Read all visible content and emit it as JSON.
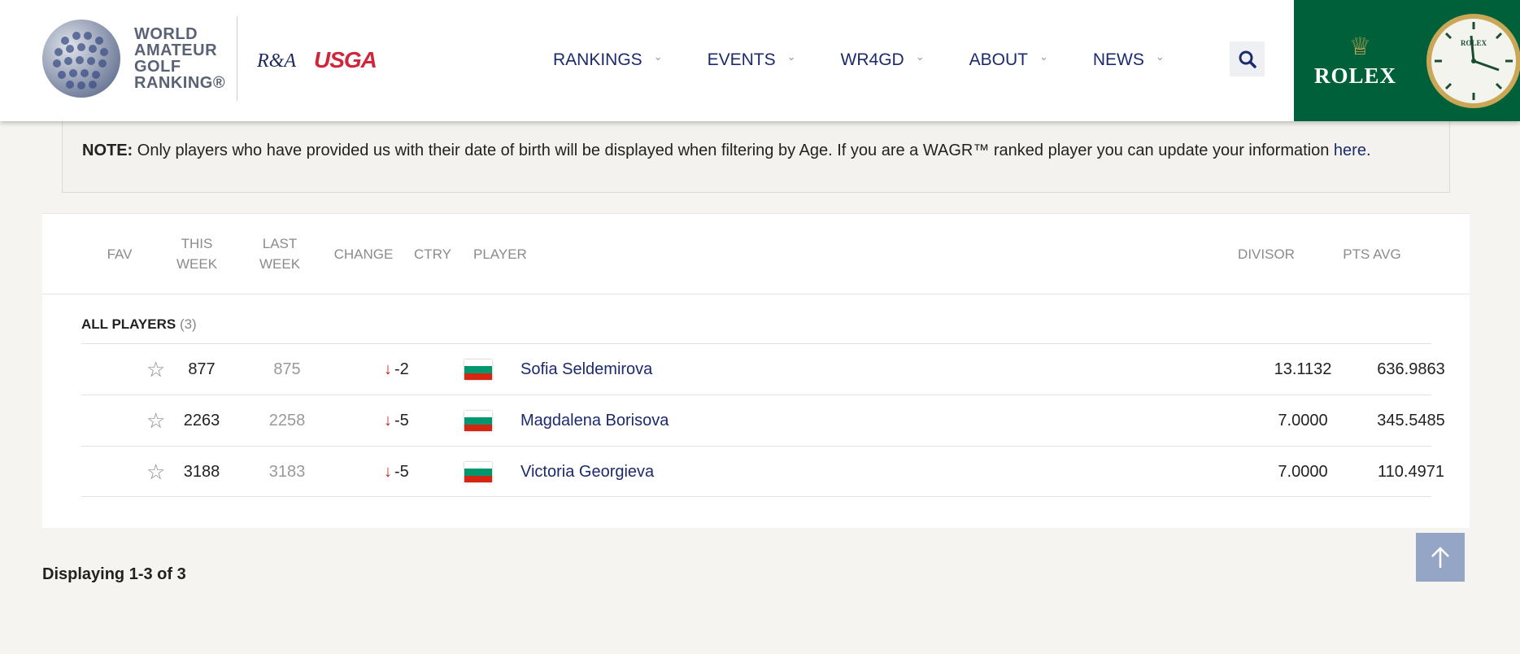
{
  "header": {
    "logo_lines": [
      "WORLD",
      "AMATEUR",
      "GOLF",
      "RANKING®"
    ],
    "partner_ra": "R&A",
    "partner_usga": "USGA",
    "nav": [
      {
        "label": "RANKINGS"
      },
      {
        "label": "EVENTS"
      },
      {
        "label": "WR4GD"
      },
      {
        "label": "ABOUT"
      },
      {
        "label": "NEWS"
      }
    ],
    "sponsor": "ROLEX",
    "search_icon": "search-icon"
  },
  "note": {
    "prefix": "NOTE:",
    "text": " Only players who have provided us with their date of birth will be displayed when filtering by Age. If you are a WAGR™ ranked player you can update your information ",
    "link": "here",
    "suffix": "."
  },
  "table": {
    "headers": {
      "fav": "FAV",
      "this_week_1": "THIS",
      "this_week_2": "WEEK",
      "last_week_1": "LAST",
      "last_week_2": "WEEK",
      "change": "CHANGE",
      "ctry": "CTRY",
      "player": "PLAYER",
      "divisor": "DIVISOR",
      "pts_avg": "PTS AVG"
    },
    "group": {
      "label": "ALL PLAYERS",
      "count": "(3)"
    },
    "rows": [
      {
        "this_week": "877",
        "last_week": "875",
        "change": "-2",
        "player": "Sofia Seldemirova",
        "divisor": "13.1132",
        "pts_avg": "636.9863"
      },
      {
        "this_week": "2263",
        "last_week": "2258",
        "change": "-5",
        "player": "Magdalena Borisova",
        "divisor": "7.0000",
        "pts_avg": "345.5485"
      },
      {
        "this_week": "3188",
        "last_week": "3183",
        "change": "-5",
        "player": "Victoria Georgieva",
        "divisor": "7.0000",
        "pts_avg": "110.4971"
      }
    ]
  },
  "footer": {
    "display_count": "Displaying 1-3 of 3"
  },
  "colors": {
    "brand_navy": "#1c2a6c",
    "rolex_green": "#006039",
    "change_down": "#c0262f",
    "flag_bg": [
      "#ffffff",
      "#00966e",
      "#d62612"
    ]
  }
}
